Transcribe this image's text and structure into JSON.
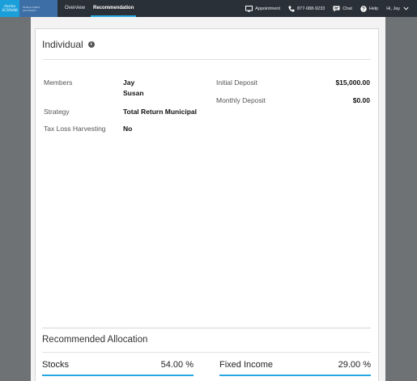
{
  "header": {
    "logo_text": [
      "charles",
      "SCHWAB"
    ],
    "brand2_text": [
      "INTELLIGENT",
      "ADVISORY"
    ],
    "tabs": [
      {
        "label": "Overview",
        "active": false
      },
      {
        "label": "Recommendation",
        "active": true
      }
    ],
    "appointment_label": "Appointment",
    "phone_label": "877-088-9233",
    "chat_label": "Chat",
    "help_label": "Help",
    "user_label": "Hi, Jay"
  },
  "account": {
    "title": "Individual",
    "members_label": "Members",
    "members": [
      "Jay",
      "Susan"
    ],
    "strategy_label": "Strategy",
    "strategy_value": "Total Return Municipal",
    "tlh_label": "Tax Loss Harvesting",
    "tlh_value": "No",
    "initial_deposit_label": "Initial Deposit",
    "initial_deposit_value": "$15,000.00",
    "monthly_deposit_label": "Monthly Deposit",
    "monthly_deposit_value": "$0.00"
  },
  "allocation": {
    "title": "Recommended Allocation",
    "items": [
      {
        "label": "Stocks",
        "value": "54.00 %"
      },
      {
        "label": "Fixed Income",
        "value": "29.00 %"
      }
    ],
    "accent_color": "#26a7df"
  },
  "colors": {
    "topbar": "#2a3038",
    "logo": "#1a9fda",
    "brand2": "#3d6fa6",
    "background": "#6f7275"
  }
}
